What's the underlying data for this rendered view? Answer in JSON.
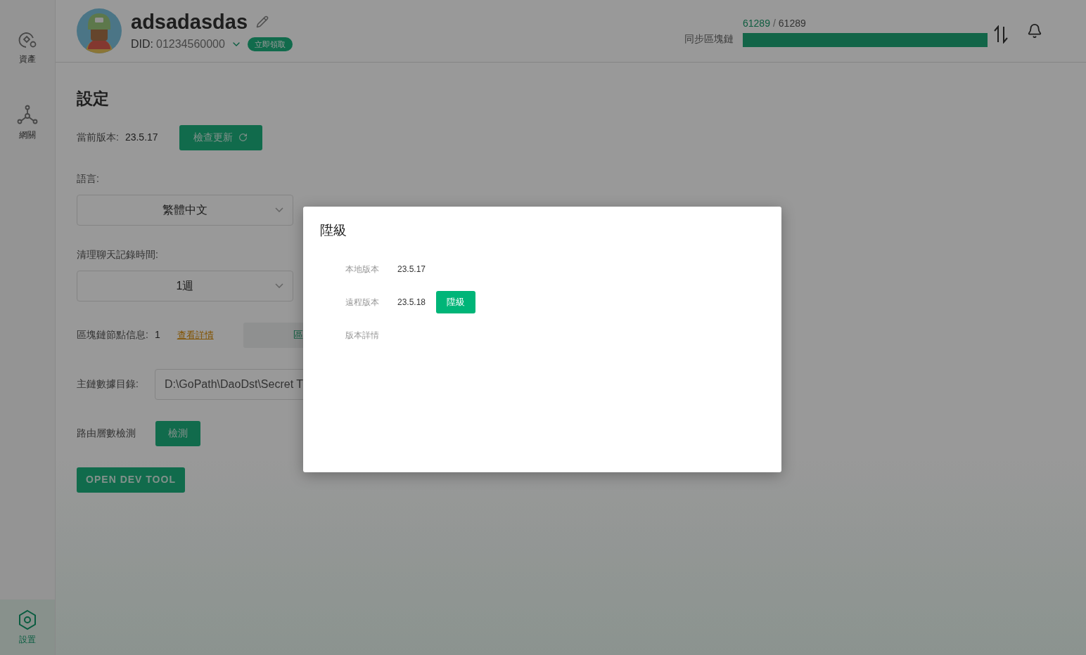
{
  "sidebar": {
    "items": [
      {
        "label": "資產",
        "selected": false
      },
      {
        "label": "網關",
        "selected": false
      },
      {
        "label": "設置",
        "selected": true
      }
    ]
  },
  "header": {
    "username": "adsadasdas",
    "did_label": "DID:",
    "did": "01234560000",
    "claim_badge": "立即領取",
    "sync": {
      "label": "同步區塊鏈",
      "current": "61289",
      "separator": "/",
      "total": "61289",
      "level": 1
    }
  },
  "settings": {
    "title": "設定",
    "version_label": "當前版本:",
    "version": "23.5.17",
    "check_update_button": "檢查更新",
    "language_label": "語言:",
    "language": "繁體中文",
    "clear_chat_label": "清理聊天記錄時間:",
    "clear_chat": "1週",
    "node_info_label": "區塊鏈節點信息:",
    "node_count": "1",
    "details_link": "查看詳情",
    "node_box_text": "區",
    "data_dir_label": "主鏈數據目錄:",
    "data_dir": "D:\\GoPath\\DaoDst\\Secret T",
    "route_label": "路由層數檢測",
    "route_button": "檢測",
    "dev_tool_button": "OPEN DEV TOOL"
  },
  "dialog": {
    "title": "陞級",
    "rows": [
      {
        "label": "本地版本",
        "value": "23.5.17"
      },
      {
        "label": "遠程版本",
        "value": "23.5.18",
        "button": "陞級"
      },
      {
        "label": "版本詳情"
      }
    ]
  }
}
